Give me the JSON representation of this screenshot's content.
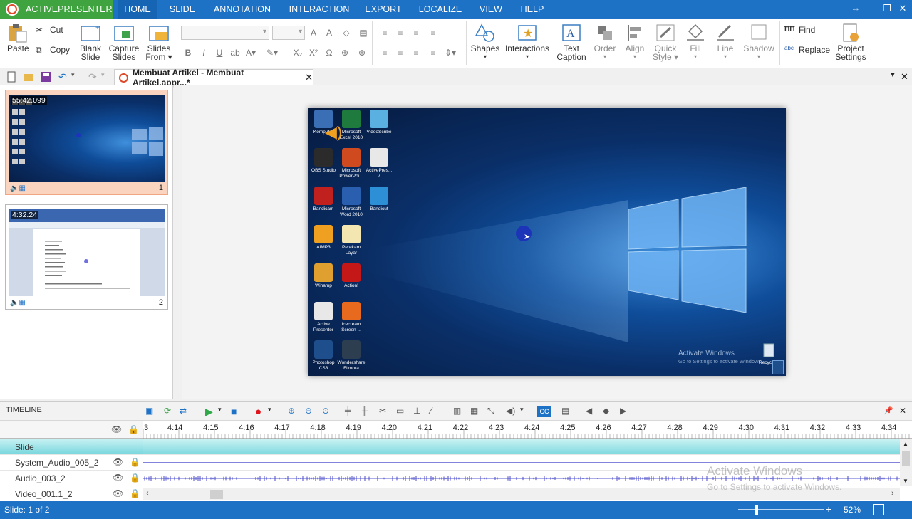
{
  "app": {
    "brand": "ACTIVEPRESENTER"
  },
  "menu": {
    "items": [
      "HOME",
      "SLIDE",
      "ANNOTATION",
      "INTERACTION",
      "EXPORT",
      "LOCALIZE",
      "VIEW",
      "HELP"
    ],
    "active": "HOME"
  },
  "ribbon": {
    "paste": "Paste",
    "cut": "Cut",
    "copy": "Copy",
    "blank_slide": [
      "Blank",
      "Slide"
    ],
    "capture_slides": [
      "Capture",
      "Slides"
    ],
    "slides_from": [
      "Slides",
      "From"
    ],
    "shapes": "Shapes",
    "interactions": "Interactions",
    "text_caption": [
      "Text",
      "Caption"
    ],
    "order": "Order",
    "align": "Align",
    "quick_style": [
      "Quick",
      "Style"
    ],
    "fill": "Fill",
    "line": "Line",
    "shadow": "Shadow",
    "find": "Find",
    "replace": "Replace",
    "project_settings": [
      "Project",
      "Settings"
    ]
  },
  "document": {
    "tab_title": "Membuat Artikel - Membuat Artikel.appr...*"
  },
  "slides": [
    {
      "time": "55:42.099",
      "number": "1",
      "selected": true
    },
    {
      "time": "4:32.24",
      "number": "2",
      "selected": false
    }
  ],
  "desktop": {
    "icons": [
      {
        "label": "Komputer",
        "color": "#3a6fb5"
      },
      {
        "label": "Microsoft Excel 2010",
        "color": "#1f7a3e"
      },
      {
        "label": "VideoScribe",
        "color": "#5ab0e0"
      },
      {
        "label": "OBS Studio",
        "color": "#2b2b2b"
      },
      {
        "label": "Microsoft PowerPoi...",
        "color": "#d04a1f"
      },
      {
        "label": "ActivePres... 7",
        "color": "#e8e8e8"
      },
      {
        "label": "Bandicam",
        "color": "#c0201e"
      },
      {
        "label": "Microsoft Word 2010",
        "color": "#2a5fb0"
      },
      {
        "label": "Bandicut",
        "color": "#2d8fd6"
      },
      {
        "label": "AIMP3",
        "color": "#f0a020"
      },
      {
        "label": "Perekam Layar",
        "color": "#f3e6b0"
      },
      {
        "label": "Winamp",
        "color": "#e0a030"
      },
      {
        "label": "Action!",
        "color": "#c41818"
      },
      {
        "label": "Active Presenter",
        "color": "#e8e8e8"
      },
      {
        "label": "Icecream Screen ...",
        "color": "#e86a1e"
      },
      {
        "label": "Photoshop CS3",
        "color": "#1f4e8c"
      },
      {
        "label": "Wondershare Filmora",
        "color": "#2c3e50"
      }
    ],
    "watermark_title": "Activate Windows",
    "watermark_sub": "Go to Settings to activate Windows.",
    "recycle_label": "Recycl"
  },
  "timeline": {
    "label": "TIMELINE",
    "ticks": [
      "3",
      "4:14",
      "4:15",
      "4:16",
      "4:17",
      "4:18",
      "4:19",
      "4:20",
      "4:21",
      "4:22",
      "4:23",
      "4:24",
      "4:25",
      "4:26",
      "4:27",
      "4:28",
      "4:29",
      "4:30",
      "4:31",
      "4:32",
      "4:33",
      "4:34"
    ],
    "tracks": [
      "Slide",
      "System_Audio_005_2",
      "Audio_003_2",
      "Video_001.1_2"
    ],
    "watermark_title": "Activate Windows",
    "watermark_sub": "Go to Settings to activate Windows."
  },
  "status": {
    "slide": "Slide: 1 of 2",
    "zoom": "52%"
  },
  "colors": {
    "menubar": "#1e72c6",
    "brand": "#3fa33f",
    "accent_orange": "#f0a682"
  }
}
